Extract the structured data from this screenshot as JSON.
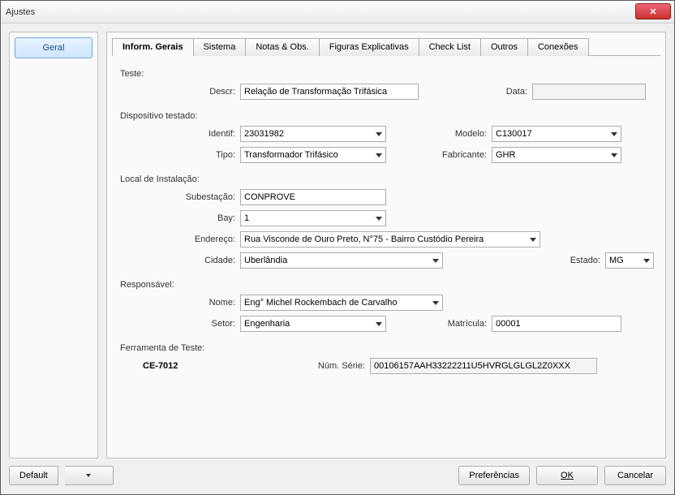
{
  "window": {
    "title": "Ajustes"
  },
  "sidebar": {
    "geral": "Geral"
  },
  "tabs": {
    "inform_gerais": "Inform. Gerais",
    "sistema": "Sistema",
    "notas_obs": "Notas & Obs.",
    "figuras": "Figuras Explicativas",
    "checklist": "Check List",
    "outros": "Outros",
    "conexoes": "Conexões"
  },
  "sections": {
    "teste": "Teste:",
    "dispositivo": "Dispositivo testado:",
    "local": "Local de Instalação:",
    "responsavel": "Responsável:",
    "ferramenta": "Ferramenta de Teste:"
  },
  "labels": {
    "descr": "Descr:",
    "data": "Data:",
    "identif": "Identif:",
    "modelo": "Modelo:",
    "tipo": "Tipo:",
    "fabricante": "Fabricante:",
    "subestacao": "Subestação:",
    "bay": "Bay:",
    "endereco": "Endereço:",
    "cidade": "Cidade:",
    "estado": "Estado:",
    "nome": "Nome:",
    "setor": "Setor:",
    "matricula": "Matrícula:",
    "num_serie": "Núm. Série:"
  },
  "values": {
    "descr": "Relação de Transformação Trifásica",
    "data": "",
    "identif": "23031982",
    "modelo": "C130017",
    "tipo": "Transformador Trifásico",
    "fabricante": "GHR",
    "subestacao": "CONPROVE",
    "bay": "1",
    "endereco": "Rua Visconde de Ouro Preto, N°75 - Bairro Custódio Pereira",
    "cidade": "Uberlândia",
    "estado": "MG",
    "nome": "Eng° Michel Rockembach de Carvalho",
    "setor": "Engenharia",
    "matricula": "00001",
    "ferramenta_modelo": "CE-7012",
    "num_serie": "00106157AAH33222211U5HVRGLGLGL2Z0XXX"
  },
  "footer": {
    "default": "Default",
    "preferencias": "Preferências",
    "ok": "OK",
    "cancelar": "Cancelar"
  }
}
